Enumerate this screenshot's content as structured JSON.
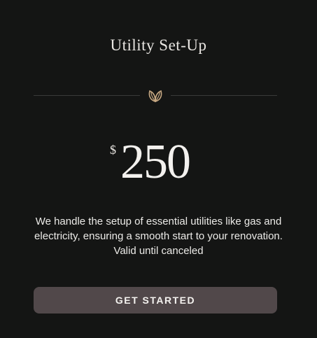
{
  "plan": {
    "title": "Utility Set-Up",
    "currency_symbol": "$",
    "price": "250",
    "description": "We handle the setup of essential utilities like gas and electricity, ensuring a smooth start to your renovation. Valid until canceled",
    "cta_label": "GET STARTED"
  },
  "icons": {
    "divider_icon": "leaf-icon"
  },
  "colors": {
    "background": "#141514",
    "accent_icon": "#c8a983",
    "button": "#51484a",
    "text": "#ecebe8"
  }
}
